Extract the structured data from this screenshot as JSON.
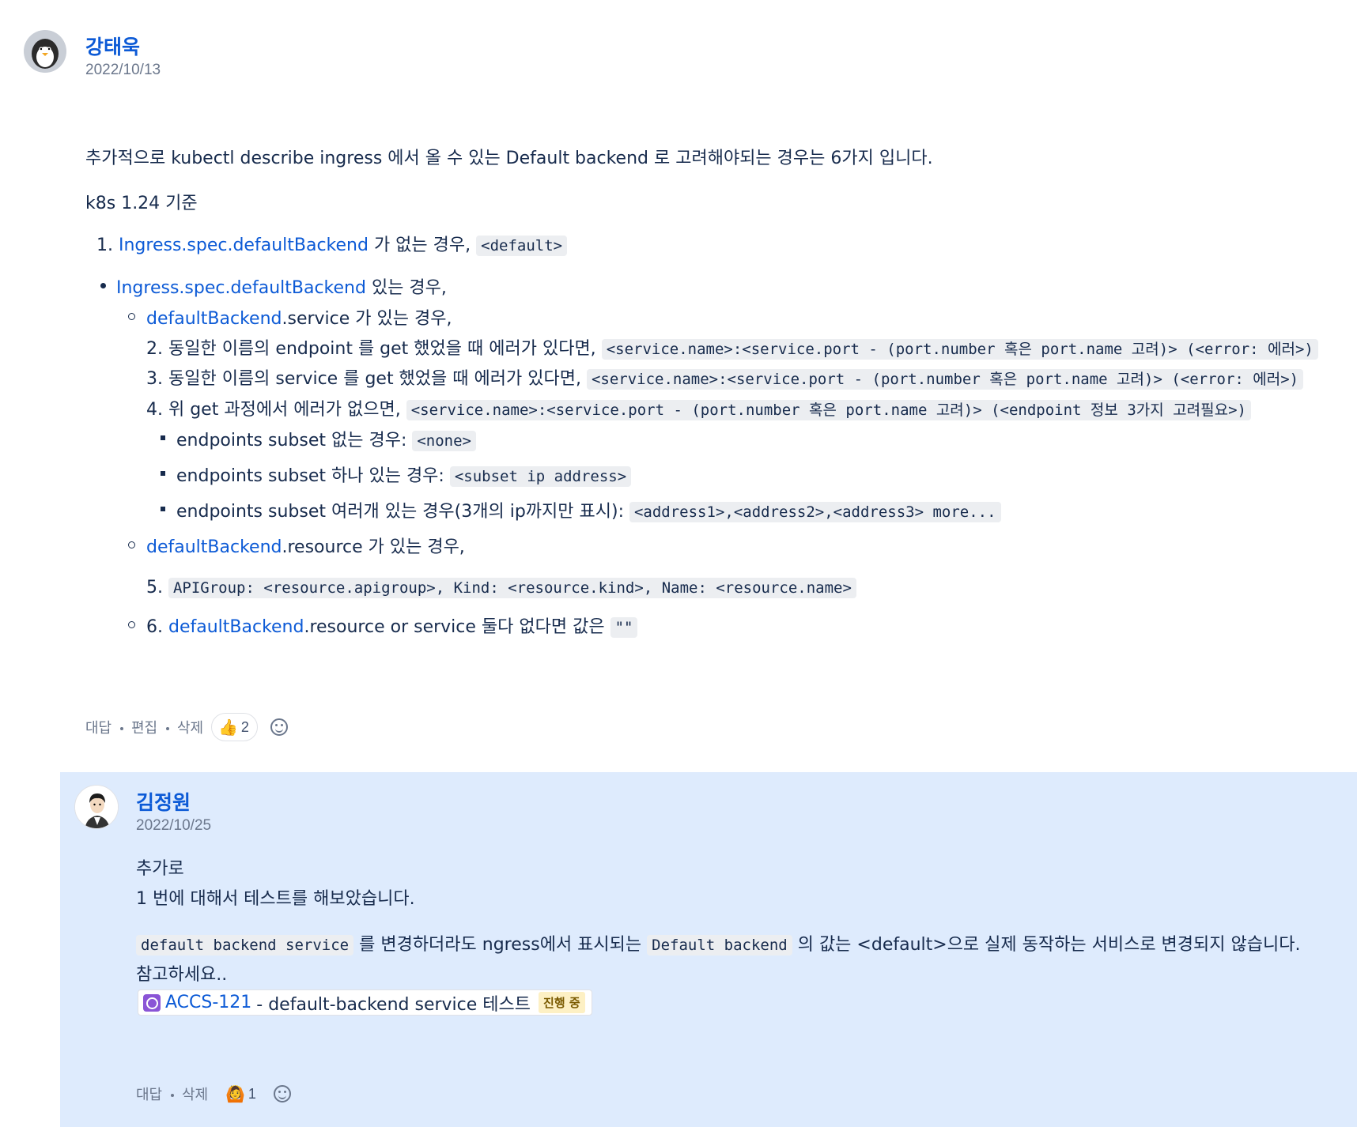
{
  "comment": {
    "author": "강태욱",
    "date": "2022/10/13",
    "intro": "추가적으로 kubectl describe ingress 에서 올 수 있는 Default backend 로 고려해야되는 경우는 6가지 입니다.",
    "version_note": "k8s 1.24 기준",
    "item1": {
      "num": "1.",
      "link": "Ingress.spec.defaultBackend",
      "text": " 가 없는 경우, ",
      "code": "<default>"
    },
    "item_exists": {
      "link": "Ingress.spec.defaultBackend",
      "text": " 있는 경우,"
    },
    "service_case": {
      "link": "defaultBackend",
      "text": ".service 가 있는 경우,"
    },
    "item2": {
      "text": "2. 동일한 이름의 endpoint 를 get 했었을 때 에러가 있다면, ",
      "code": "<service.name>:<service.port - (port.number 혹은 port.name 고려)> (<error: 에러>)"
    },
    "item3": {
      "text": "3. 동일한 이름의 service 를 get 했었을 때 에러가 있다면, ",
      "code": "<service.name>:<service.port - (port.number 혹은 port.name 고려)> (<error: 에러>)"
    },
    "item4": {
      "text": "4. 위 get 과정에서 에러가 없으면, ",
      "code": "<service.name>:<service.port - (port.number 혹은 port.name 고려)> (<endpoint 정보 3가지 고려필요>)"
    },
    "sub1": {
      "text": "endpoints subset 없는 경우: ",
      "code": "<none>"
    },
    "sub2": {
      "text": "endpoints subset 하나 있는 경우: ",
      "code": "<subset ip address>"
    },
    "sub3": {
      "text": "endpoints subset 여러개 있는 경우(3개의 ip까지만 표시): ",
      "code": "<address1>,<address2>,<address3> more..."
    },
    "resource_case": {
      "link": "defaultBackend",
      "text": ".resource 가 있는 경우,"
    },
    "item5": {
      "num": "5. ",
      "code": "APIGroup: <resource.apigroup>, Kind: <resource.kind>, Name: <resource.name>"
    },
    "item6": {
      "num": "6. ",
      "link": "defaultBackend",
      "text": ".resource or service 둘다 없다면 값은 ",
      "code": "\"\""
    },
    "actions": {
      "reply": "대답",
      "edit": "편집",
      "delete": "삭제"
    },
    "reaction": {
      "emoji": "👍",
      "count": "2"
    }
  },
  "reply": {
    "author": "김정원",
    "date": "2022/10/25",
    "line1": "추가로",
    "line2": "1 번에 대해서 테스트를 해보았습니다.",
    "line3_code1": "default backend service",
    "line3_text1": " 를 변경하더라도 ngress에서 표시되는 ",
    "line3_code2": "Default backend",
    "line3_text2": " 의 값는 <default>으로 실제 동작하는 서비스로 변경되지 않습니다.",
    "line4": "참고하세요..",
    "jira": {
      "key": "ACCS-121",
      "title": " - default-backend service 테스트",
      "status": "진행 중"
    },
    "actions": {
      "reply": "대답",
      "delete": "삭제"
    },
    "reaction": {
      "emoji": "🙆",
      "count": "1"
    }
  },
  "colors": {
    "link": "#0c5ad6",
    "reply_bg": "#deebfd",
    "code_bg": "#eceef1"
  }
}
